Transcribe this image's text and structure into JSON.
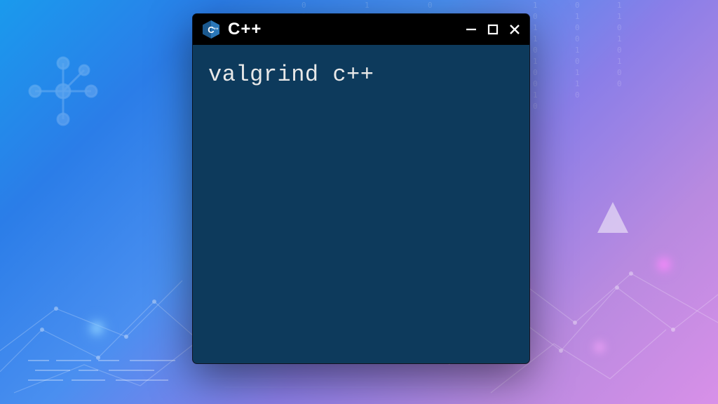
{
  "window": {
    "title": "C++",
    "icon_name": "cpp-logo-icon"
  },
  "terminal": {
    "content": "valgrind c++"
  },
  "colors": {
    "titlebar_bg": "#000000",
    "terminal_bg": "#0d3a5c",
    "terminal_fg": "#e8e8e8"
  }
}
